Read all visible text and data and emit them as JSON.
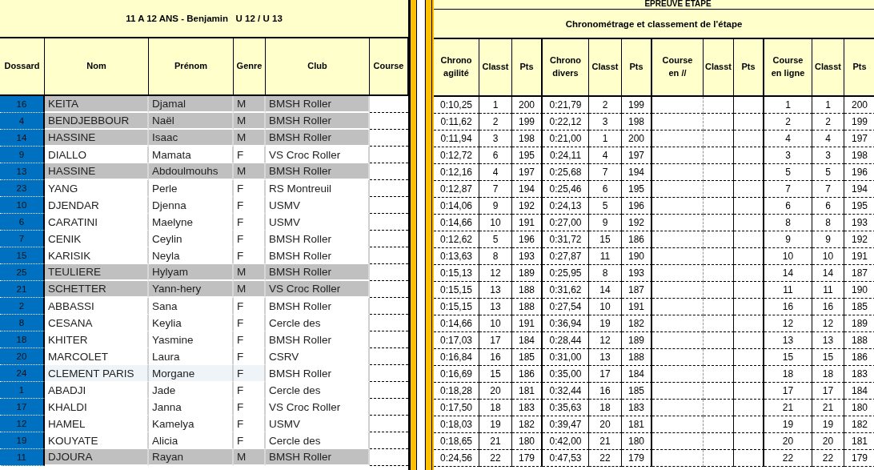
{
  "left_header": {
    "title": "11 A 12 ANS - Benjamin   U 12 / U 13"
  },
  "left_columns": [
    "Dossard",
    "Nom",
    "Prénom",
    "Genre",
    "Club",
    "Course"
  ],
  "right_header": {
    "section": "EPREUVE ETAPE",
    "subtitle": "Chronométrage et classement de l'étape"
  },
  "right_columns": [
    "Chrono\nagilité",
    "Classt",
    "Pts",
    "Chrono\ndivers",
    "Classt",
    "Pts",
    "Course\nen //",
    "Classt",
    "Pts",
    "Course\nen ligne",
    "Classt",
    "Pts"
  ],
  "rows": [
    {
      "dossard": "16",
      "nom": "KEITA",
      "prenom": "Djamal",
      "genre": "M",
      "club": "BMSH Roller",
      "shaded": true,
      "highlighted": false,
      "chrono_agilite": "0:10,25",
      "classt_agilite": "1",
      "pts_agilite": "200",
      "chrono_divers": "0:21,79",
      "classt_divers": "2",
      "pts_divers": "199",
      "course_en_ligne": "1",
      "classt_ligne": "1",
      "pts_ligne": "200"
    },
    {
      "dossard": "4",
      "nom": "BENDJEBBOUR",
      "prenom": "Naël",
      "genre": "M",
      "club": "BMSH Roller",
      "shaded": true,
      "highlighted": false,
      "chrono_agilite": "0:11,62",
      "classt_agilite": "2",
      "pts_agilite": "199",
      "chrono_divers": "0:22,12",
      "classt_divers": "3",
      "pts_divers": "198",
      "course_en_ligne": "2",
      "classt_ligne": "2",
      "pts_ligne": "199"
    },
    {
      "dossard": "14",
      "nom": "HASSINE",
      "prenom": "Isaac",
      "genre": "M",
      "club": "BMSH Roller",
      "shaded": true,
      "highlighted": false,
      "chrono_agilite": "0:11,94",
      "classt_agilite": "3",
      "pts_agilite": "198",
      "chrono_divers": "0:21,00",
      "classt_divers": "1",
      "pts_divers": "200",
      "course_en_ligne": "4",
      "classt_ligne": "4",
      "pts_ligne": "197"
    },
    {
      "dossard": "9",
      "nom": "DIALLO",
      "prenom": "Mamata",
      "genre": "F",
      "club": "VS Croc Roller",
      "shaded": false,
      "highlighted": false,
      "chrono_agilite": "0:12,72",
      "classt_agilite": "6",
      "pts_agilite": "195",
      "chrono_divers": "0:24,11",
      "classt_divers": "4",
      "pts_divers": "197",
      "course_en_ligne": "3",
      "classt_ligne": "3",
      "pts_ligne": "198"
    },
    {
      "dossard": "13",
      "nom": "HASSINE",
      "prenom": "Abdoulmouhs",
      "genre": "M",
      "club": "BMSH Roller",
      "shaded": true,
      "highlighted": false,
      "chrono_agilite": "0:12,16",
      "classt_agilite": "4",
      "pts_agilite": "197",
      "chrono_divers": "0:25,68",
      "classt_divers": "7",
      "pts_divers": "194",
      "course_en_ligne": "5",
      "classt_ligne": "5",
      "pts_ligne": "196"
    },
    {
      "dossard": "23",
      "nom": "YANG",
      "prenom": "Perle",
      "genre": "F",
      "club": "RS Montreuil",
      "shaded": false,
      "highlighted": false,
      "chrono_agilite": "0:12,87",
      "classt_agilite": "7",
      "pts_agilite": "194",
      "chrono_divers": "0:25,46",
      "classt_divers": "6",
      "pts_divers": "195",
      "course_en_ligne": "7",
      "classt_ligne": "7",
      "pts_ligne": "194"
    },
    {
      "dossard": "10",
      "nom": "DJENDAR",
      "prenom": "Djenna",
      "genre": "F",
      "club": "USMV",
      "shaded": false,
      "highlighted": false,
      "chrono_agilite": "0:14,06",
      "classt_agilite": "9",
      "pts_agilite": "192",
      "chrono_divers": "0:24,13",
      "classt_divers": "5",
      "pts_divers": "196",
      "course_en_ligne": "6",
      "classt_ligne": "6",
      "pts_ligne": "195"
    },
    {
      "dossard": "6",
      "nom": "CARATINI",
      "prenom": "Maelyne",
      "genre": "F",
      "club": "USMV",
      "shaded": false,
      "highlighted": false,
      "chrono_agilite": "0:14,66",
      "classt_agilite": "10",
      "pts_agilite": "191",
      "chrono_divers": "0:27,00",
      "classt_divers": "9",
      "pts_divers": "192",
      "course_en_ligne": "8",
      "classt_ligne": "8",
      "pts_ligne": "193"
    },
    {
      "dossard": "7",
      "nom": "CENIK",
      "prenom": "Ceylin",
      "genre": "F",
      "club": "BMSH Roller",
      "shaded": false,
      "highlighted": false,
      "chrono_agilite": "0:12,62",
      "classt_agilite": "5",
      "pts_agilite": "196",
      "chrono_divers": "0:31,72",
      "classt_divers": "15",
      "pts_divers": "186",
      "course_en_ligne": "9",
      "classt_ligne": "9",
      "pts_ligne": "192"
    },
    {
      "dossard": "15",
      "nom": "KARISIK",
      "prenom": "Neyla",
      "genre": "F",
      "club": "BMSH Roller",
      "shaded": false,
      "highlighted": false,
      "chrono_agilite": "0:13,63",
      "classt_agilite": "8",
      "pts_agilite": "193",
      "chrono_divers": "0:27,87",
      "classt_divers": "11",
      "pts_divers": "190",
      "course_en_ligne": "10",
      "classt_ligne": "10",
      "pts_ligne": "191"
    },
    {
      "dossard": "25",
      "nom": "TEULIERE",
      "prenom": "Hylyam",
      "genre": "M",
      "club": "BMSH Roller",
      "shaded": true,
      "highlighted": false,
      "chrono_agilite": "0:15,13",
      "classt_agilite": "12",
      "pts_agilite": "189",
      "chrono_divers": "0:25,95",
      "classt_divers": "8",
      "pts_divers": "193",
      "course_en_ligne": "14",
      "classt_ligne": "14",
      "pts_ligne": "187"
    },
    {
      "dossard": "21",
      "nom": "SCHETTER",
      "prenom": "Yann-hery",
      "genre": "M",
      "club": "VS Croc Roller",
      "shaded": true,
      "highlighted": false,
      "chrono_agilite": "0:15,15",
      "classt_agilite": "13",
      "pts_agilite": "188",
      "chrono_divers": "0:31,62",
      "classt_divers": "14",
      "pts_divers": "187",
      "course_en_ligne": "11",
      "classt_ligne": "11",
      "pts_ligne": "190"
    },
    {
      "dossard": "2",
      "nom": "ABBASSI",
      "prenom": "Sana",
      "genre": "F",
      "club": "BMSH Roller",
      "shaded": false,
      "highlighted": false,
      "chrono_agilite": "0:15,15",
      "classt_agilite": "13",
      "pts_agilite": "188",
      "chrono_divers": "0:27,54",
      "classt_divers": "10",
      "pts_divers": "191",
      "course_en_ligne": "16",
      "classt_ligne": "16",
      "pts_ligne": "185"
    },
    {
      "dossard": "8",
      "nom": "CESANA",
      "prenom": "Keylia",
      "genre": "F",
      "club": "Cercle des",
      "shaded": false,
      "highlighted": false,
      "chrono_agilite": "0:14,66",
      "classt_agilite": "10",
      "pts_agilite": "191",
      "chrono_divers": "0:36,94",
      "classt_divers": "19",
      "pts_divers": "182",
      "course_en_ligne": "12",
      "classt_ligne": "12",
      "pts_ligne": "189"
    },
    {
      "dossard": "18",
      "nom": "KHITER",
      "prenom": "Yasmine",
      "genre": "F",
      "club": "BMSH Roller",
      "shaded": false,
      "highlighted": false,
      "chrono_agilite": "0:17,03",
      "classt_agilite": "17",
      "pts_agilite": "184",
      "chrono_divers": "0:28,44",
      "classt_divers": "12",
      "pts_divers": "189",
      "course_en_ligne": "13",
      "classt_ligne": "13",
      "pts_ligne": "188"
    },
    {
      "dossard": "20",
      "nom": "MARCOLET",
      "prenom": "Laura",
      "genre": "F",
      "club": "CSRV",
      "shaded": false,
      "highlighted": false,
      "chrono_agilite": "0:16,84",
      "classt_agilite": "16",
      "pts_agilite": "185",
      "chrono_divers": "0:31,00",
      "classt_divers": "13",
      "pts_divers": "188",
      "course_en_ligne": "15",
      "classt_ligne": "15",
      "pts_ligne": "186"
    },
    {
      "dossard": "24",
      "nom": "CLEMENT PARIS",
      "prenom": "Morgane",
      "genre": "F",
      "club": "BMSH Roller",
      "shaded": false,
      "highlighted": true,
      "chrono_agilite": "0:16,69",
      "classt_agilite": "15",
      "pts_agilite": "186",
      "chrono_divers": "0:35,00",
      "classt_divers": "17",
      "pts_divers": "184",
      "course_en_ligne": "18",
      "classt_ligne": "18",
      "pts_ligne": "183"
    },
    {
      "dossard": "1",
      "nom": "ABADJI",
      "prenom": "Jade",
      "genre": "F",
      "club": "Cercle des",
      "shaded": false,
      "highlighted": false,
      "chrono_agilite": "0:18,28",
      "classt_agilite": "20",
      "pts_agilite": "181",
      "chrono_divers": "0:32,44",
      "classt_divers": "16",
      "pts_divers": "185",
      "course_en_ligne": "17",
      "classt_ligne": "17",
      "pts_ligne": "184"
    },
    {
      "dossard": "17",
      "nom": "KHALDI",
      "prenom": "Janna",
      "genre": "F",
      "club": "VS Croc Roller",
      "shaded": false,
      "highlighted": false,
      "chrono_agilite": "0:17,50",
      "classt_agilite": "18",
      "pts_agilite": "183",
      "chrono_divers": "0:35,63",
      "classt_divers": "18",
      "pts_divers": "183",
      "course_en_ligne": "21",
      "classt_ligne": "21",
      "pts_ligne": "180"
    },
    {
      "dossard": "12",
      "nom": "HAMEL",
      "prenom": "Kamelya",
      "genre": "F",
      "club": "USMV",
      "shaded": false,
      "highlighted": false,
      "chrono_agilite": "0:18,03",
      "classt_agilite": "19",
      "pts_agilite": "182",
      "chrono_divers": "0:39,47",
      "classt_divers": "20",
      "pts_divers": "181",
      "course_en_ligne": "19",
      "classt_ligne": "19",
      "pts_ligne": "182"
    },
    {
      "dossard": "19",
      "nom": "KOUYATE",
      "prenom": "Alicia",
      "genre": "F",
      "club": "Cercle des",
      "shaded": false,
      "highlighted": false,
      "chrono_agilite": "0:18,65",
      "classt_agilite": "21",
      "pts_agilite": "180",
      "chrono_divers": "0:42,00",
      "classt_divers": "21",
      "pts_divers": "180",
      "course_en_ligne": "20",
      "classt_ligne": "20",
      "pts_ligne": "181"
    },
    {
      "dossard": "11",
      "nom": "DJOURA",
      "prenom": "Rayan",
      "genre": "M",
      "club": "BMSH Roller",
      "shaded": true,
      "highlighted": false,
      "chrono_agilite": "0:24,56",
      "classt_agilite": "22",
      "pts_agilite": "179",
      "chrono_divers": "0:47,53",
      "classt_divers": "22",
      "pts_divers": "179",
      "course_en_ligne": "22",
      "classt_ligne": "22",
      "pts_ligne": "179"
    }
  ]
}
